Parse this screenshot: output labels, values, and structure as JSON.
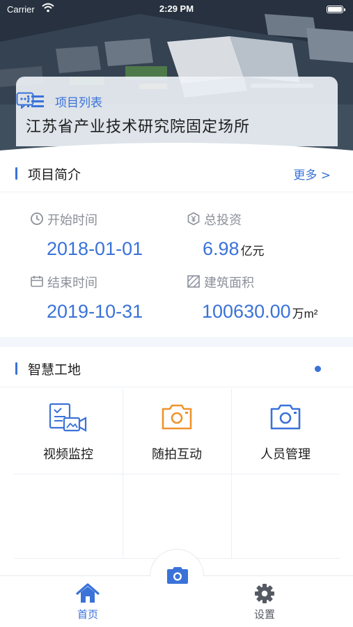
{
  "status_bar": {
    "carrier": "Carrier",
    "time": "2:29 PM"
  },
  "project_card": {
    "list_label": "项目列表",
    "project_name": "江苏省产业技术研究院固定场所"
  },
  "intro_section": {
    "title": "项目简介",
    "more": "更多 >"
  },
  "info": {
    "start": {
      "label": "开始时间",
      "value": "2018-01-01"
    },
    "investment": {
      "label": "总投资",
      "value": "6.98",
      "unit": "亿元"
    },
    "end": {
      "label": "结束时间",
      "value": "2019-10-31"
    },
    "area": {
      "label": "建筑面积",
      "value": "100630.00",
      "unit": "万m²"
    }
  },
  "smart_section": {
    "title": "智慧工地"
  },
  "tiles": [
    {
      "label": "视频监控",
      "icon": "video-monitor-icon"
    },
    {
      "label": "随拍互动",
      "icon": "camera-orange-icon"
    },
    {
      "label": "人员管理",
      "icon": "camera-blue-icon"
    }
  ],
  "tabbar": {
    "home": {
      "label": "首页",
      "icon": "home-icon"
    },
    "settings": {
      "label": "设置",
      "icon": "gear-icon"
    },
    "center": {
      "icon": "camera-icon"
    }
  },
  "colors": {
    "accent": "#3a72d8",
    "orange": "#f0932b",
    "active_tab": "#3a72d8",
    "inactive_tab": "#555a63"
  }
}
